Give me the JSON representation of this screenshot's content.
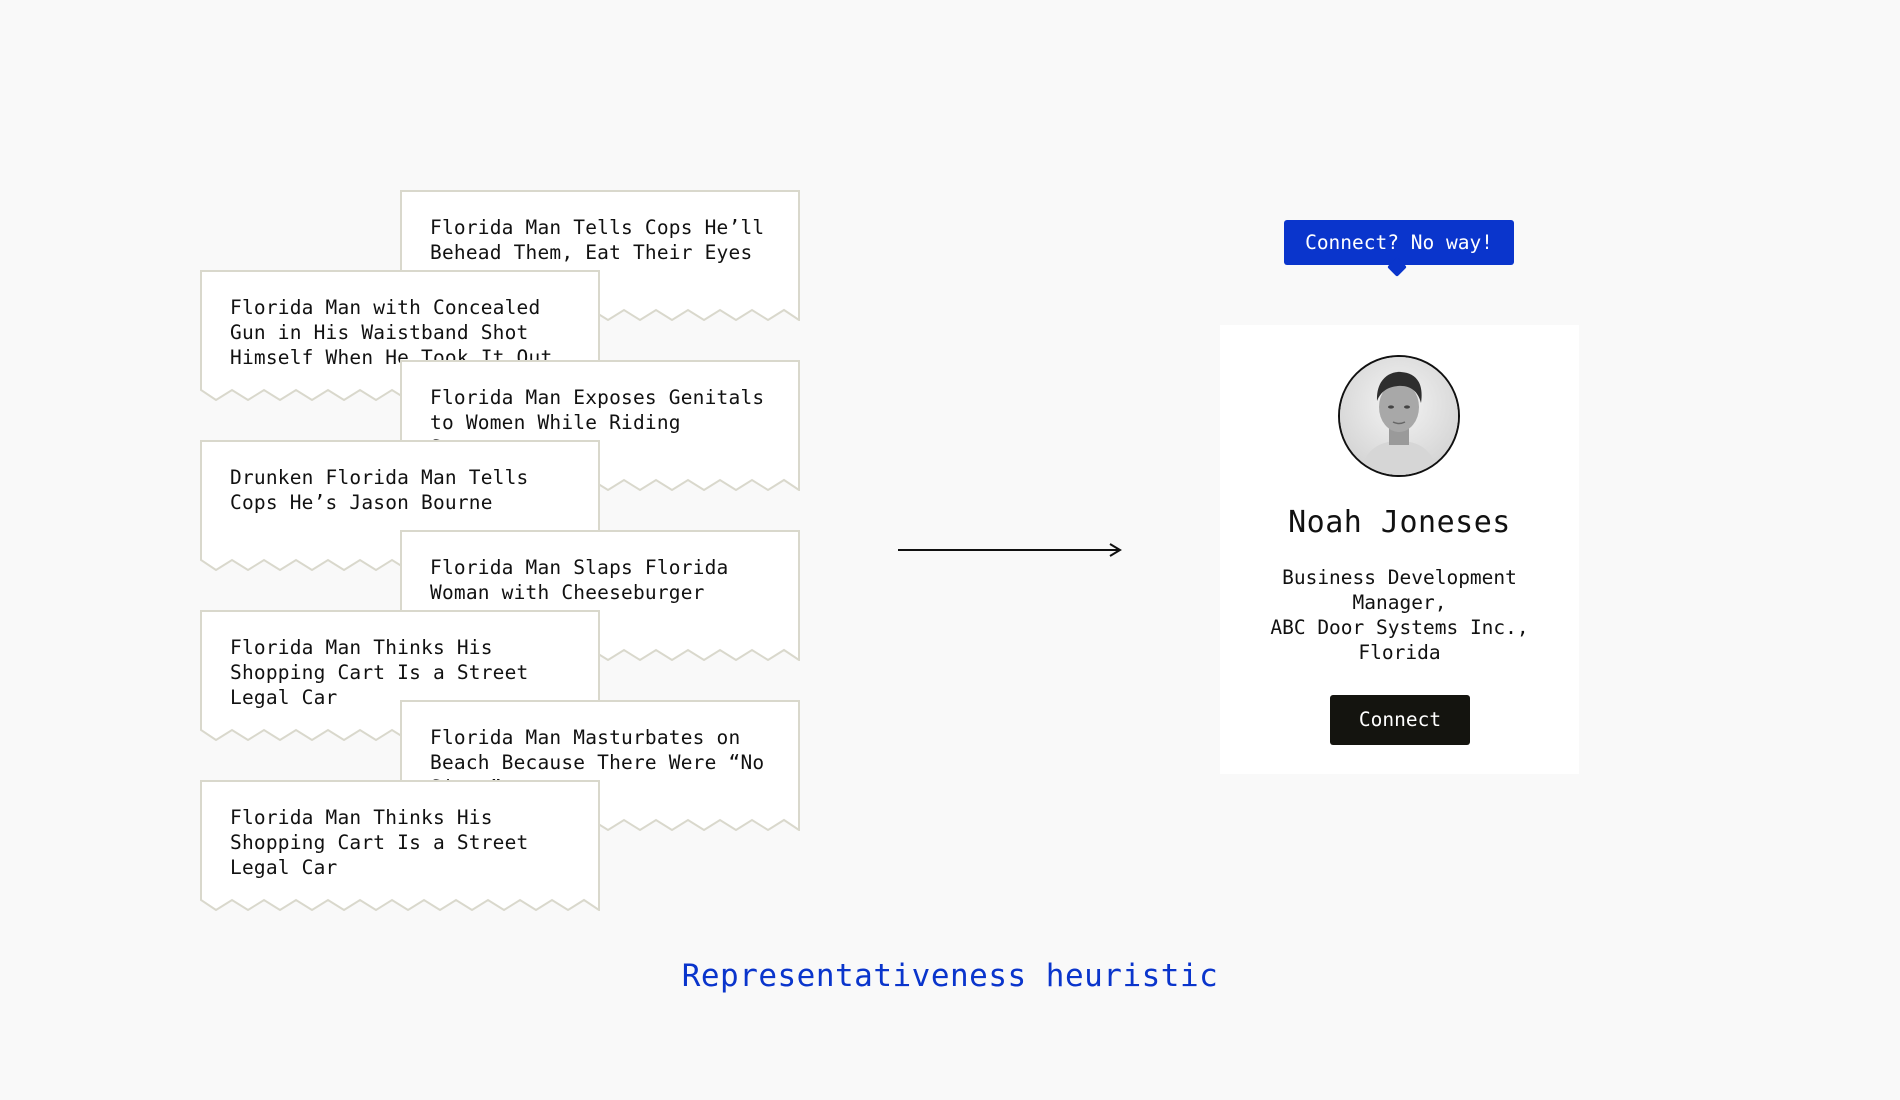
{
  "headlines": [
    "Florida Man Tells Cops He’ll Behead Them, Eat Their Eyes",
    "Florida Man with Concealed Gun in His Waistband Shot Himself When He Took It Out",
    "Florida Man Exposes Genitals to Women While Riding Scooter",
    "Drunken Florida Man Tells Cops He’s Jason Bourne",
    "Florida Man Slaps Florida Woman with Cheeseburger",
    "Florida Man Thinks His Shopping Cart Is a Street Legal Car",
    "Florida Man Masturbates on Beach Because There Were “No Signs”",
    "Florida Man Thinks His Shopping Cart Is a Street Legal Car"
  ],
  "tooltip": {
    "text": "Connect? No way!"
  },
  "profile": {
    "name": "Noah Joneses",
    "role": "Business Development Manager,\nABC Door Systems Inc., Florida",
    "connect_label": "Connect"
  },
  "caption": "Representativeness heuristic",
  "colors": {
    "accent": "#0a35cc",
    "button": "#14140f",
    "paper_border": "#d9d8cc",
    "background": "#f9f9f9"
  }
}
